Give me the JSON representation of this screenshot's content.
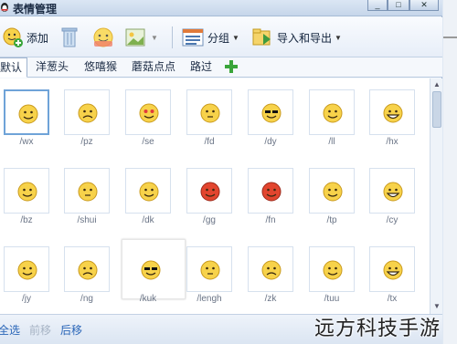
{
  "window": {
    "title": "表情管理"
  },
  "toolbar": {
    "add_label": "添加",
    "group_label": "分组",
    "import_export_label": "导入和导出"
  },
  "tabs": [
    "默认",
    "洋葱头",
    "悠嘻猴",
    "蘑菇点点",
    "路过"
  ],
  "emoticons": [
    {
      "code": "/wx"
    },
    {
      "code": "/pz"
    },
    {
      "code": "/se"
    },
    {
      "code": "/fd"
    },
    {
      "code": "/dy"
    },
    {
      "code": "/ll"
    },
    {
      "code": "/hx"
    },
    {
      "code": "/bz"
    },
    {
      "code": "/shui"
    },
    {
      "code": "/dk"
    },
    {
      "code": "/gg"
    },
    {
      "code": "/fn"
    },
    {
      "code": "/tp"
    },
    {
      "code": "/cy"
    },
    {
      "code": "/jy"
    },
    {
      "code": "/ng"
    },
    {
      "code": "/kuk"
    },
    {
      "code": "/lengh"
    },
    {
      "code": "/zk"
    },
    {
      "code": "/tuu"
    },
    {
      "code": "/tx"
    }
  ],
  "bottom": {
    "select_all": "全选",
    "move_forward": "前移",
    "move_back": "后移"
  },
  "watermark": "远方科技手游",
  "colors": {
    "accent": "#2a66b8",
    "face_yellow": "#f7d24a",
    "face_red": "#e2452e",
    "selected_border": "#6fa3d8"
  }
}
